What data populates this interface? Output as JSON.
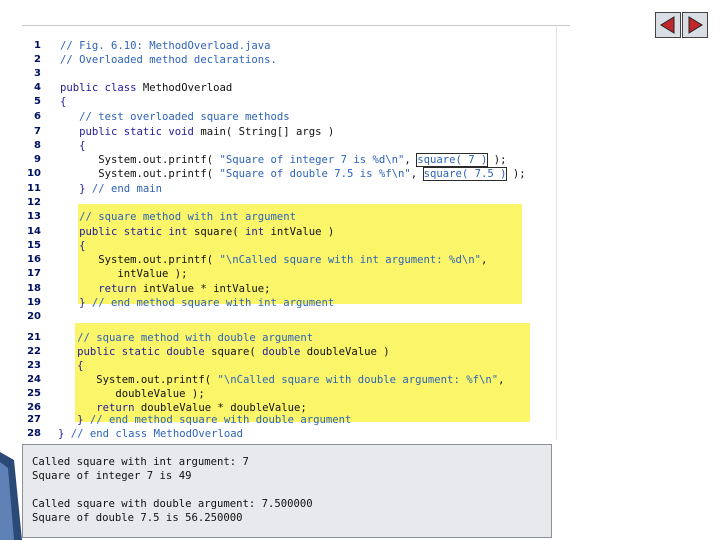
{
  "lines": [
    {
      "n": "1",
      "parts": [
        {
          "t": "c",
          "x": "// Fig. 6.10: MethodOverload.java"
        }
      ]
    },
    {
      "n": "2",
      "parts": [
        {
          "t": "c",
          "x": "// Overloaded method declarations."
        }
      ]
    },
    {
      "n": "3",
      "parts": []
    },
    {
      "n": "4",
      "parts": [
        {
          "t": "k",
          "x": "public class "
        },
        {
          "t": "t",
          "x": "MethodOverload"
        }
      ]
    },
    {
      "n": "5",
      "parts": [
        {
          "t": "k",
          "x": "{"
        }
      ]
    },
    {
      "n": "6",
      "parts": [
        {
          "t": "c",
          "x": "   // test overloaded square methods"
        }
      ]
    },
    {
      "n": "7",
      "parts": [
        {
          "t": "k",
          "x": "   public static void "
        },
        {
          "t": "t",
          "x": "main( String[] args )"
        }
      ]
    },
    {
      "n": "8",
      "parts": [
        {
          "t": "k",
          "x": "   {"
        }
      ]
    },
    {
      "n": "9",
      "parts": [
        {
          "t": "t",
          "x": "      System.out.printf( "
        },
        {
          "t": "s",
          "x": "\"Square of integer 7 is %d\\n\""
        },
        {
          "t": "t",
          "x": ", "
        },
        {
          "t": "b",
          "x": "square( 7 )"
        },
        {
          "t": "t",
          "x": " );"
        }
      ]
    },
    {
      "n": "10",
      "parts": [
        {
          "t": "t",
          "x": "      System.out.printf( "
        },
        {
          "t": "s",
          "x": "\"Square of double 7.5 is %f\\n\""
        },
        {
          "t": "t",
          "x": ", "
        },
        {
          "t": "b",
          "x": "square( 7.5 )"
        },
        {
          "t": "t",
          "x": " );"
        }
      ]
    },
    {
      "n": "11",
      "parts": [
        {
          "t": "k",
          "x": "   } "
        },
        {
          "t": "c",
          "x": "// end main"
        }
      ]
    },
    {
      "n": "12",
      "parts": []
    },
    {
      "n": "13",
      "parts": [
        {
          "t": "c",
          "x": "   // square method with int argument"
        }
      ]
    },
    {
      "n": "14",
      "parts": [
        {
          "t": "k",
          "x": "   public static int "
        },
        {
          "t": "t",
          "x": "square( "
        },
        {
          "t": "k",
          "x": "int "
        },
        {
          "t": "t",
          "x": "intValue )"
        }
      ]
    },
    {
      "n": "15",
      "parts": [
        {
          "t": "k",
          "x": "   {"
        }
      ]
    },
    {
      "n": "16",
      "parts": [
        {
          "t": "t",
          "x": "      System.out.printf( "
        },
        {
          "t": "s",
          "x": "\"\\nCalled square with int argument: %d\\n\""
        },
        {
          "t": "t",
          "x": ","
        }
      ]
    },
    {
      "n": "17",
      "parts": [
        {
          "t": "t",
          "x": "         intValue );"
        }
      ]
    },
    {
      "n": "18",
      "parts": [
        {
          "t": "k",
          "x": "      return "
        },
        {
          "t": "t",
          "x": "intValue * intValue;"
        }
      ]
    },
    {
      "n": "19",
      "parts": [
        {
          "t": "k",
          "x": "   } "
        },
        {
          "t": "c",
          "x": "// end method square with int argument"
        }
      ]
    },
    {
      "n": "20",
      "parts": []
    },
    {
      "n": "21",
      "parts": [
        {
          "t": "c",
          "x": "   // square method with double argument"
        }
      ]
    },
    {
      "n": "22",
      "parts": [
        {
          "t": "k",
          "x": "   public static double "
        },
        {
          "t": "t",
          "x": "square( "
        },
        {
          "t": "k",
          "x": "double "
        },
        {
          "t": "t",
          "x": "doubleValue )"
        }
      ]
    },
    {
      "n": "23",
      "parts": [
        {
          "t": "k",
          "x": "   {"
        }
      ]
    },
    {
      "n": "24",
      "parts": [
        {
          "t": "t",
          "x": "      System.out.printf( "
        },
        {
          "t": "s",
          "x": "\"\\nCalled square with double argument: %f\\n\""
        },
        {
          "t": "t",
          "x": ","
        }
      ]
    },
    {
      "n": "25",
      "parts": [
        {
          "t": "t",
          "x": "         doubleValue );"
        }
      ]
    },
    {
      "n": "26",
      "parts": [
        {
          "t": "k",
          "x": "      return "
        },
        {
          "t": "t",
          "x": "doubleValue * doubleValue;"
        }
      ]
    },
    {
      "n": "27",
      "parts": [
        {
          "t": "k",
          "x": "   } "
        },
        {
          "t": "c",
          "x": "// end method square with double argument"
        }
      ]
    },
    {
      "n": "28",
      "parts": [
        {
          "t": "k",
          "x": "} "
        },
        {
          "t": "c",
          "x": "// end class MethodOverload"
        }
      ]
    }
  ],
  "output_lines": [
    "Called square with int argument: 7",
    "Square of integer 7 is 49",
    "",
    "Called square with double argument: 7.500000",
    "Square of double 7.5 is 56.250000"
  ],
  "nav": {
    "prev_icon": "triangle-left-icon",
    "next_icon": "triangle-right-icon"
  },
  "colors": {
    "highlight": "#fbf56a",
    "comment": "#2e64b8",
    "keyword": "#1f1b9a",
    "text": "#111111",
    "output_bg": "#e8e9ec"
  }
}
